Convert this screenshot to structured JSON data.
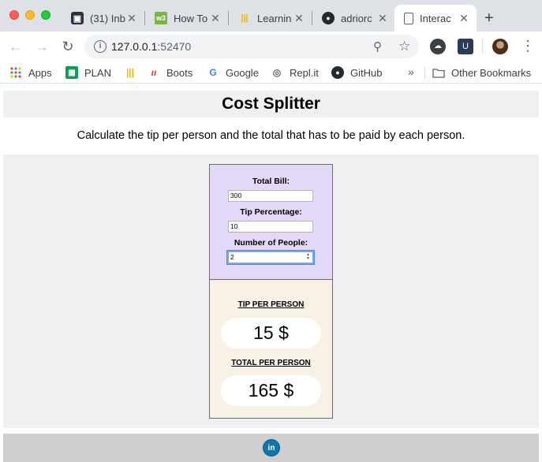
{
  "browser": {
    "tabs": [
      {
        "title": "(31) Inb",
        "icon": "inbox-icon",
        "active": false
      },
      {
        "title": "How To",
        "icon": "w3-icon",
        "active": false
      },
      {
        "title": "Learnin",
        "icon": "bars-icon",
        "active": false
      },
      {
        "title": "adriorc",
        "icon": "github-icon",
        "active": false
      },
      {
        "title": "Interac",
        "icon": "document-icon",
        "active": true
      }
    ],
    "url_host": "127.0.0.1",
    "url_port": ":52470",
    "bookmarks": [
      {
        "label": "Apps",
        "icon": "apps-grid-icon"
      },
      {
        "label": "PLAN",
        "icon": "sheets-icon"
      },
      {
        "label": "",
        "icon": "bars-icon"
      },
      {
        "label": "Boots",
        "icon": "boots-icon"
      },
      {
        "label": "Google",
        "icon": "google-icon"
      },
      {
        "label": "Repl.it",
        "icon": "replit-icon"
      },
      {
        "label": "GitHub",
        "icon": "github-icon"
      }
    ],
    "more_bookmarks": "»",
    "other_bookmarks": "Other Bookmarks"
  },
  "page": {
    "title": "Cost Splitter",
    "subtitle": "Calculate the tip per person and the total that has to be paid by each person.",
    "form": {
      "bill_label": "Total Bill:",
      "bill_value": "300",
      "tip_label": "Tip Percentage:",
      "tip_value": "10",
      "people_label": "Number of People:",
      "people_value": "2"
    },
    "results": {
      "tip_label": "TIP PER PERSON",
      "tip_value": "15 $",
      "total_label": "TOTAL PER PERSON",
      "total_value": "165 $"
    },
    "footer_icon": "linkedin-icon"
  },
  "colors": {
    "form_bg": "#e3d8f7",
    "results_bg": "#f8f2e6",
    "section_bg": "#f0eff1",
    "footer_bg": "#cfced1",
    "linkedin": "#0e76a8"
  }
}
